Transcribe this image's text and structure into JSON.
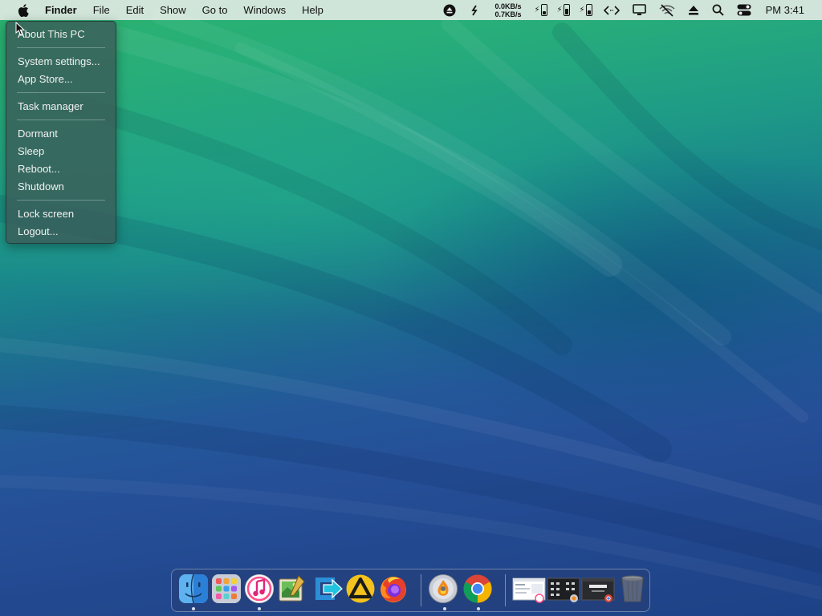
{
  "menubar": {
    "app_name": "Finder",
    "menus": [
      "File",
      "Edit",
      "Show",
      "Go to",
      "Windows",
      "Help"
    ],
    "status": {
      "upload_speed": "0.0KB/s",
      "download_speed": "0.7KB/s",
      "clock": "PM 3:41"
    }
  },
  "apple_menu": {
    "items": [
      "About This PC",
      "System settings...",
      "App Store...",
      "Task manager",
      "Dormant",
      "Sleep",
      "Reboot...",
      "Shutdown",
      "Lock screen",
      "Logout..."
    ]
  },
  "dock": {
    "apps": [
      {
        "icon": "finder-icon"
      },
      {
        "icon": "launchpad-icon"
      },
      {
        "icon": "itunes-icon"
      },
      {
        "icon": "image-editor-icon"
      },
      {
        "icon": "remote-desktop-icon"
      },
      {
        "icon": "triangle-app-icon"
      },
      {
        "icon": "firefox-icon"
      },
      {
        "icon": "disc-burner-icon"
      },
      {
        "icon": "chrome-icon"
      },
      {
        "icon": "window-thumbnail-1-icon"
      },
      {
        "icon": "window-thumbnail-2-icon"
      },
      {
        "icon": "window-thumbnail-3-icon"
      },
      {
        "icon": "trash-icon"
      }
    ]
  }
}
